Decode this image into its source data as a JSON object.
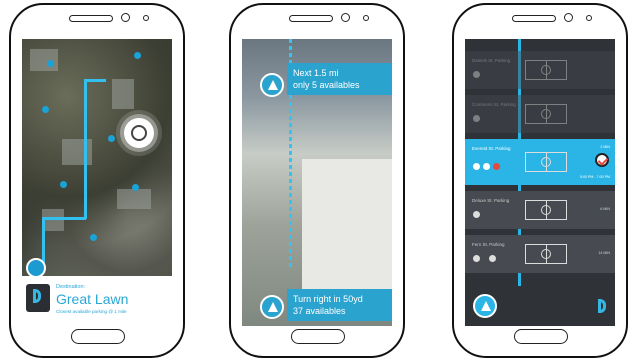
{
  "screen1": {
    "destination_label": "Destination:",
    "destination_name": "Great Lawn",
    "destination_subtext": "Closest available parking @ 1 mile"
  },
  "screen2": {
    "top_instruction": {
      "line1": "Next 1.5 mi",
      "line2": "only 5 availables"
    },
    "bottom_instruction": {
      "line1": "Turn right in 50yd",
      "line2": "37 availables"
    }
  },
  "screen3": {
    "rows": [
      {
        "name": "Daniels St. Parking",
        "time": "",
        "state": "dim"
      },
      {
        "name": "Commons St. Parking",
        "time": "",
        "state": "dim"
      },
      {
        "name": "Everest St. Parking",
        "time": "2 MIN",
        "hours": "5:00 PM - 7:00 PM",
        "state": "active"
      },
      {
        "name": "Deluxe St. Parking",
        "time": "6 MIN",
        "state": "normal"
      },
      {
        "name": "Fern St. Parking",
        "time": "14 MIN",
        "state": "normal"
      }
    ]
  },
  "colors": {
    "accent": "#2ab5e6",
    "dark": "#2f3237",
    "alert": "#e5493f"
  }
}
